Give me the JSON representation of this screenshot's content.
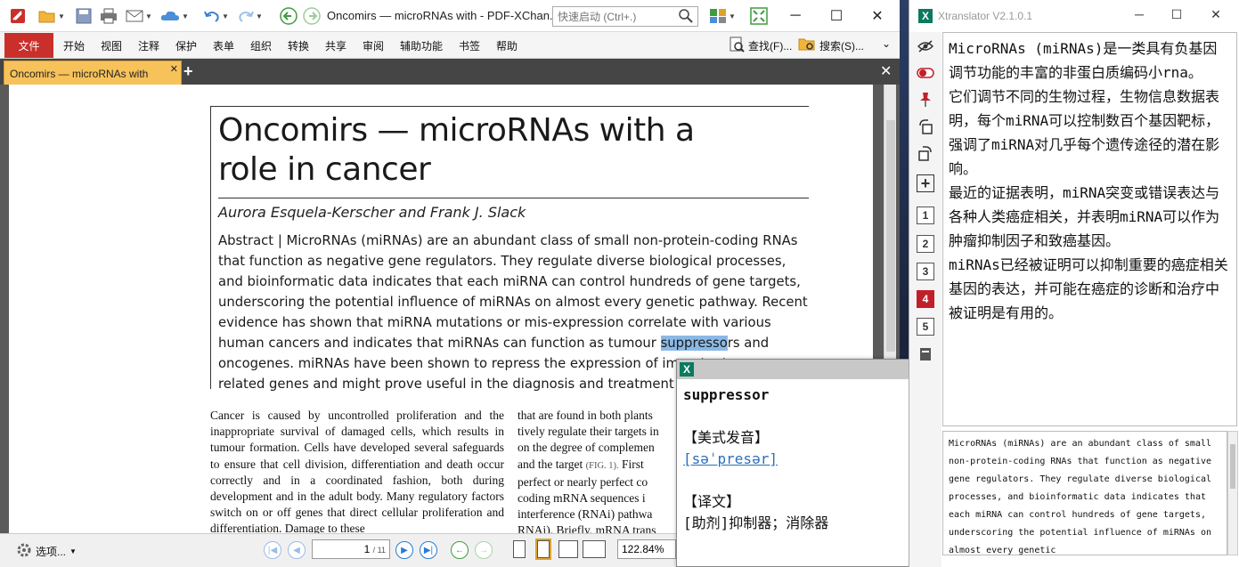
{
  "pdf": {
    "doc_title": "Oncomirs — microRNAs with - PDF-XChan...",
    "quick_search_placeholder": "快速启动 (Ctrl+.)",
    "menu": {
      "file": "文件",
      "items": [
        "开始",
        "视图",
        "注释",
        "保护",
        "表单",
        "组织",
        "转换",
        "共享",
        "审阅",
        "辅助功能",
        "书签",
        "帮助"
      ],
      "find": "查找(F)...",
      "search": "搜索(S)..."
    },
    "tab_label": "Oncomirs — microRNAs with",
    "article": {
      "title": "Oncomirs — microRNAs with a role in cancer",
      "authors": "Aurora Esquela-Kerscher and Frank J. Slack",
      "abstract_before": "Abstract | MicroRNAs (miRNAs) are an abundant class of small non-protein-coding RNAs that function as negative gene regulators. They regulate diverse biological processes, and bioinformatic data indicates that each miRNA can control hundreds of gene targets, underscoring the potential influence of miRNAs on almost every genetic pathway. Recent evidence has shown that miRNA mutations or mis-expression correlate with various human cancers and indicates that miRNAs can function as tumour ",
      "abstract_highlight": "suppresso",
      "abstract_after": "rs and oncogenes. miRNAs have been shown to repress the expression of important cancer-related genes and might prove useful in the diagnosis and treatment of cancer.",
      "col1": "Cancer is caused by uncontrolled proliferation and the inappropriate survival of damaged cells, which results in tumour formation. Cells have developed several safeguards to ensure that cell division, differentiation and death occur correctly and in a coordinated fashion, both during development and in the adult body. Many regulatory factors switch on or off genes that direct cellular proliferation and differentiation. Damage to these",
      "col2_lines": [
        "that are found in both plants",
        "tively regulate their targets in",
        "on the degree of complemen",
        "and the target",
        "perfect or nearly perfect co",
        "coding mRNA sequences i",
        "interference (RNAi) pathwa",
        "RNAi). Briefly, mRNA trans"
      ],
      "col2_fig": "(FIG. 1).",
      "col2_fig_after": " First"
    },
    "status": {
      "options": "选项...",
      "page_current": "1",
      "page_total": "/ 11",
      "zoom": "122.84%"
    }
  },
  "popup": {
    "word": "suppressor",
    "pron_header": "【美式发音】",
    "phonetic": "[səˈpresər]",
    "trans_header": "【译文】",
    "translation": "[助剂]抑制器；消除器"
  },
  "xtranslator": {
    "title": "Xtranslator V2.1.0.1",
    "output_paragraphs": [
      "MicroRNAs (miRNAs)是一类具有负基因调节功能的丰富的非蛋白质编码小rna。",
      "它们调节不同的生物过程，生物信息数据表明，每个miRNA可以控制数百个基因靶标，强调了miRNA对几乎每个遗传途径的潜在影响。",
      "最近的证据表明，miRNA突变或错误表达与各种人类癌症相关，并表明miRNA可以作为肿瘤抑制因子和致癌基因。",
      "miRNAs已经被证明可以抑制重要的癌症相关基因的表达，并可能在癌症的诊断和治疗中被证明是有用的。"
    ],
    "input_text": "MicroRNAs (miRNAs) are an abundant class of small non-protein-coding RNAs  that function as negative gene regulators. They regulate diverse biological processes, and  bioinformatic data indicates that each miRNA can control hundreds of gene targets,  underscoring the potential influence of miRNAs on almost every genetic",
    "num_buttons": [
      "1",
      "2",
      "3",
      "4",
      "5"
    ],
    "active_num": "4"
  },
  "colors": {
    "accent_red": "#c9302c",
    "tab_orange": "#f7c25a",
    "highlight_blue": "#8bb9e6",
    "xt_logo_green": "#0b7a5e"
  },
  "icons": [
    "pdfxchange-logo-icon",
    "open-folder-icon",
    "save-icon",
    "print-icon",
    "email-icon",
    "cloud-icon",
    "undo-icon",
    "redo-icon",
    "back-icon",
    "forward-icon",
    "search-icon",
    "plugin-icon",
    "fullscreen-icon",
    "minimize-icon",
    "maximize-icon",
    "close-icon",
    "eye-off-icon",
    "toggle-icon",
    "pin-icon",
    "copy-icon",
    "rotate-icon",
    "plus-icon",
    "gear-icon"
  ]
}
